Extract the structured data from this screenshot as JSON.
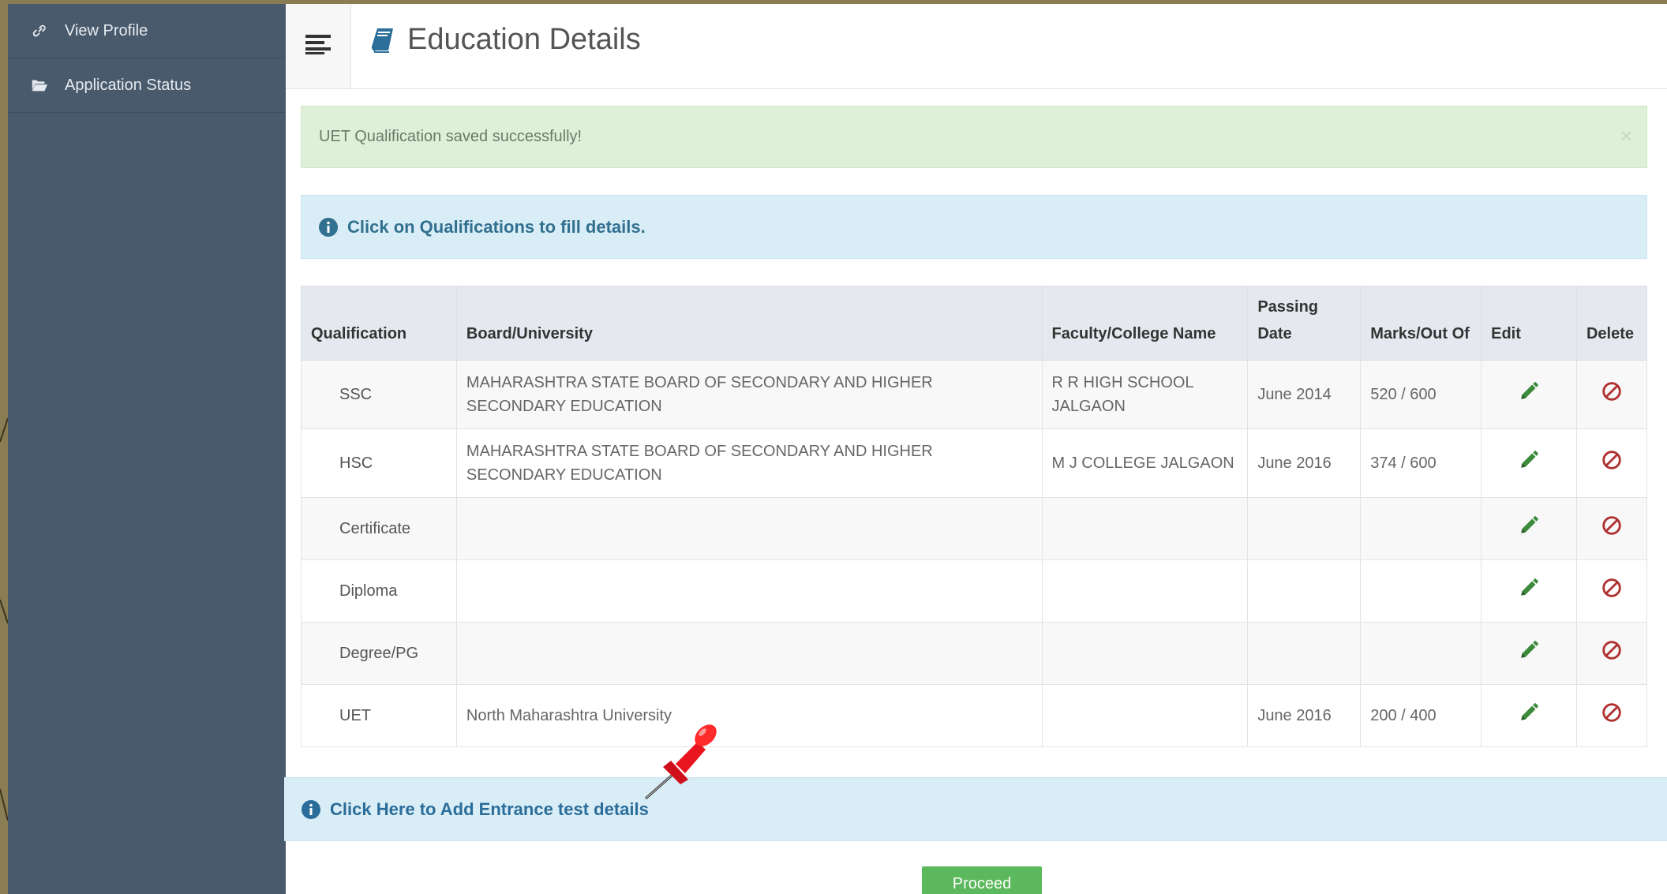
{
  "sidebar": {
    "items": [
      {
        "label": "View Profile",
        "icon": "link-icon"
      },
      {
        "label": "Application Status",
        "icon": "folder-open-icon"
      }
    ]
  },
  "header": {
    "title": "Education Details",
    "title_icon": "book-icon",
    "menu_icon": "hamburger-menu-icon"
  },
  "alerts": {
    "success_text": "UET Qualification saved successfully!",
    "close_symbol": "×",
    "info_text": "Click on Qualifications to fill details."
  },
  "table": {
    "headers": {
      "qualification": "Qualification",
      "board": "Board/University",
      "faculty": "Faculty/College Name",
      "passing_date": "Passing Date",
      "marks": "Marks/Out Of",
      "edit": "Edit",
      "delete": "Delete"
    },
    "rows": [
      {
        "qualification": "SSC",
        "board": "MAHARASHTRA STATE BOARD OF SECONDARY AND HIGHER SECONDARY EDUCATION",
        "faculty": "R R HIGH SCHOOL JALGAON",
        "passing_date": "June 2014",
        "marks": "520 / 600"
      },
      {
        "qualification": "HSC",
        "board": "MAHARASHTRA STATE BOARD OF SECONDARY AND HIGHER SECONDARY EDUCATION",
        "faculty": "M J COLLEGE JALGAON",
        "passing_date": "June 2016",
        "marks": "374 / 600"
      },
      {
        "qualification": "Certificate",
        "board": "",
        "faculty": "",
        "passing_date": "",
        "marks": ""
      },
      {
        "qualification": "Diploma",
        "board": "",
        "faculty": "",
        "passing_date": "",
        "marks": ""
      },
      {
        "qualification": "Degree/PG",
        "board": "",
        "faculty": "",
        "passing_date": "",
        "marks": ""
      },
      {
        "qualification": "UET",
        "board": "North Maharashtra University",
        "faculty": "",
        "passing_date": "June 2016",
        "marks": "200 / 400"
      }
    ]
  },
  "entrance": {
    "link_text": "Click Here to Add Entrance test details"
  },
  "proceed_label": "Proceed",
  "colors": {
    "sidebar_bg": "#4a5a6d",
    "success_bg": "#dff0d8",
    "info_bg": "#d9edf7",
    "edit_green": "#3c8a3c",
    "delete_red": "#b03030",
    "proceed_green": "#5cb85c"
  }
}
